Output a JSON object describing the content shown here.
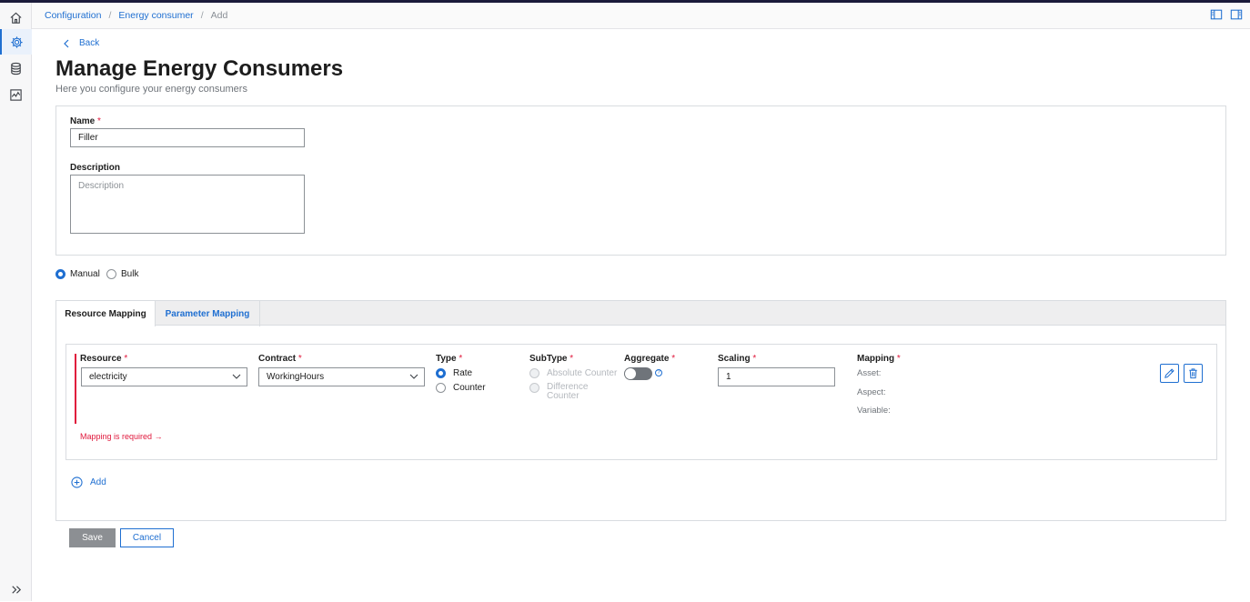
{
  "breadcrumb": {
    "items": [
      "Configuration",
      "Energy consumer"
    ],
    "current": "Add",
    "separator": "/"
  },
  "back": {
    "label": "Back"
  },
  "page": {
    "title": "Manage Energy Consumers",
    "subtitle": "Here you configure your energy consumers"
  },
  "form": {
    "name_label": "Name",
    "name_value": "Filler",
    "description_label": "Description",
    "description_placeholder": "Description",
    "required_mark": "*"
  },
  "mode": {
    "manual": "Manual",
    "bulk": "Bulk",
    "selected": "Manual"
  },
  "tabs": [
    {
      "label": "Resource Mapping",
      "active": true
    },
    {
      "label": "Parameter Mapping",
      "active": false
    }
  ],
  "mapping_row": {
    "resource_label": "Resource",
    "resource_value": "electricity",
    "contract_label": "Contract",
    "contract_value": "WorkingHours",
    "type_label": "Type",
    "type_options": [
      "Rate",
      "Counter"
    ],
    "type_selected": "Rate",
    "subtype_label": "SubType",
    "subtype_options": [
      "Absolute Counter",
      "Difference Counter"
    ],
    "aggregate_label": "Aggregate",
    "aggregate_on": false,
    "help_glyph": "?",
    "scaling_label": "Scaling",
    "scaling_value": "1",
    "mapping_label": "Mapping",
    "mapping_lines": [
      "Asset:",
      "Aspect:",
      "Variable:"
    ],
    "error_message": "Mapping is required",
    "error_arrow": "→"
  },
  "add": {
    "label": "Add"
  },
  "actions": {
    "save": "Save",
    "cancel": "Cancel"
  },
  "colors": {
    "accent": "#1f6fd1",
    "error": "#e0183c",
    "top_bar": "#1b1b3a",
    "save_disabled": "#8c8f93"
  },
  "icons": [
    "home-icon",
    "gear-icon",
    "database-icon",
    "chart-icon",
    "expand-icon",
    "panel-left-icon",
    "panel-right-icon",
    "chevron-left-icon",
    "chevron-down-icon",
    "pencil-icon",
    "trash-icon",
    "add-circle-icon"
  ]
}
